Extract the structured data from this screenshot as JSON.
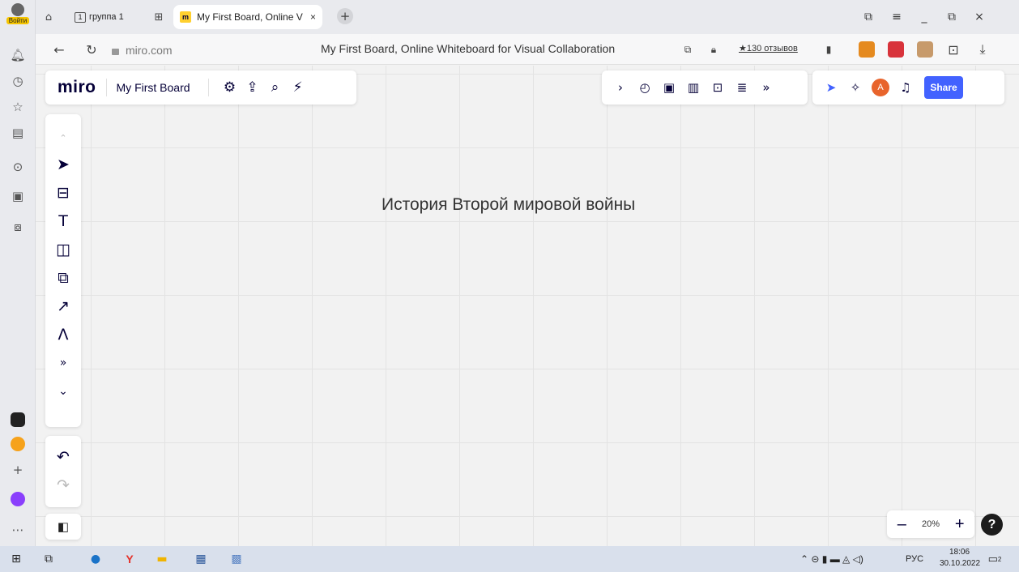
{
  "browser": {
    "login_label": "Войти",
    "group_number": "1",
    "group_label": "группа 1",
    "tab_title": "My First Board, Online V",
    "tab_close": "×",
    "new_tab": "+",
    "url": "miro.com",
    "page_title": "My First Board, Online Whiteboard for Visual Collaboration",
    "reviews": "★130 отзывов",
    "window": {
      "minimize": "_",
      "maximize": "⧉",
      "close": "×"
    }
  },
  "miro": {
    "logo": "miro",
    "board_name": "My First Board",
    "share_label": "Share",
    "avatar_initial": "A",
    "board_text": "История Второй мировой войны",
    "zoom_level": "20%",
    "zoom_out": "–",
    "zoom_in": "+",
    "help": "?"
  },
  "taskbar": {
    "language": "РУС",
    "time": "18:06",
    "date": "30.10.2022",
    "notifications": "2"
  },
  "colors": {
    "accent": "#4262ff",
    "miro_yellow": "#ffd02f",
    "avatar": "#e8642c"
  }
}
